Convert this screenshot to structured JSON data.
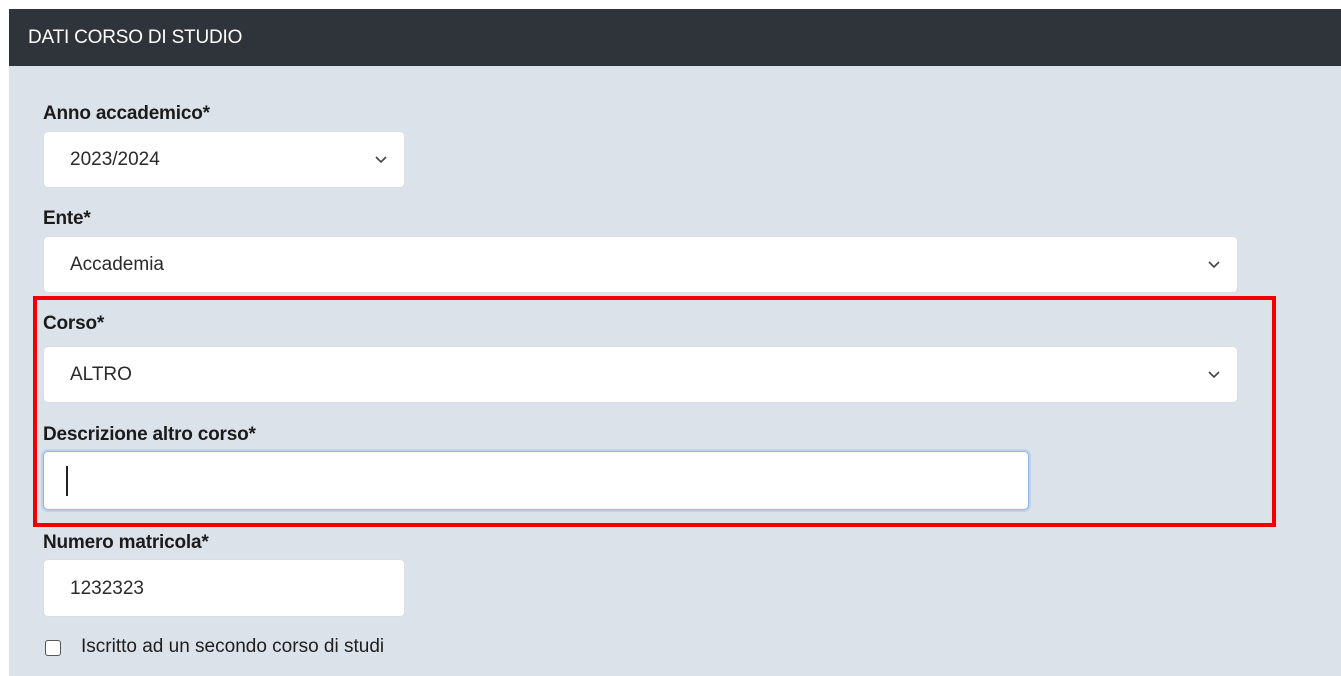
{
  "header": {
    "title": "DATI CORSO DI STUDIO"
  },
  "form": {
    "anno": {
      "label": "Anno accademico*",
      "value": "2023/2024"
    },
    "ente": {
      "label": "Ente*",
      "value": "Accademia"
    },
    "corso": {
      "label": "Corso*",
      "value": "ALTRO"
    },
    "descrizione": {
      "label": "Descrizione altro corso*",
      "value": ""
    },
    "matricola": {
      "label": "Numero matricola*",
      "value": "1232323"
    },
    "secondo_corso": {
      "label": "Iscritto ad un secondo corso di studi",
      "checked": false
    }
  },
  "colors": {
    "header_bg": "#2e343a",
    "panel_bg": "#dbe2ea",
    "highlight": "#f20000",
    "focus_border": "#8fb8e6"
  },
  "icons": {
    "select_arrow": "chevron-down-icon"
  }
}
